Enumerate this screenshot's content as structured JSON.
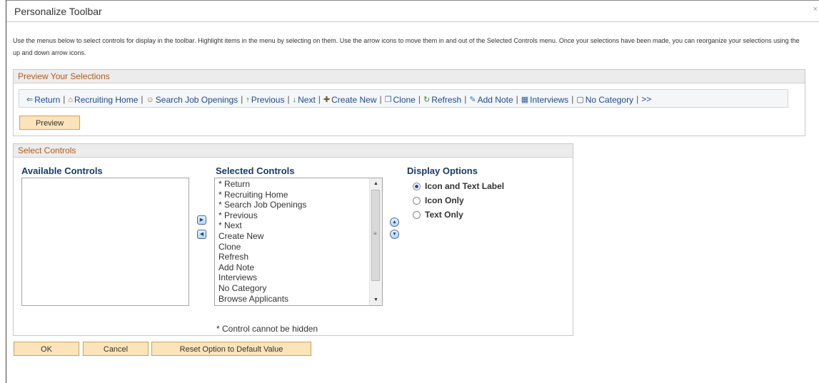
{
  "window": {
    "title": "Personalize Toolbar",
    "close_glyph": "×"
  },
  "intro": {
    "text": "Use the menus below to select controls for display in the toolbar. Highlight items in the menu by selecting on them. Use the arrow icons to move them in and out of the Selected Controls menu. Once your selections have been made, you can reorganize your selections using the up and down arrow icons."
  },
  "preview_section": {
    "title": "Preview Your Selections",
    "toolbar_items": [
      {
        "label": "Return",
        "icon": "return-arrow-icon"
      },
      {
        "label": "Recruiting Home",
        "icon": "home-icon"
      },
      {
        "label": "Search Job Openings",
        "icon": "search-people-icon"
      },
      {
        "label": "Previous",
        "icon": "previous-list-icon"
      },
      {
        "label": "Next",
        "icon": "next-list-icon"
      },
      {
        "label": "Create New",
        "icon": "create-new-icon"
      },
      {
        "label": "Clone",
        "icon": "clone-icon"
      },
      {
        "label": "Refresh",
        "icon": "refresh-icon"
      },
      {
        "label": "Add Note",
        "icon": "add-note-icon"
      },
      {
        "label": "Interviews",
        "icon": "calendar-icon"
      },
      {
        "label": "No Category",
        "icon": "dashed-box-icon"
      }
    ],
    "separator": "|",
    "more_label": ">>",
    "preview_button": "Preview"
  },
  "select_section": {
    "title": "Select Controls",
    "available_heading": "Available Controls",
    "selected_heading": "Selected Controls",
    "display_heading": "Display Options",
    "available_items": [],
    "selected_items": [
      "* Return",
      "* Recruiting Home",
      "* Search Job Openings",
      "* Previous",
      "* Next",
      "Create New",
      "Clone",
      "Refresh",
      "Add Note",
      "Interviews",
      "No Category",
      "Browse Applicants"
    ],
    "display_options": [
      {
        "label": "Icon and Text Label",
        "checked": true
      },
      {
        "label": "Icon Only",
        "checked": false
      },
      {
        "label": "Text Only",
        "checked": false
      }
    ],
    "footnote": "* Control cannot be hidden",
    "scroll_grip": "≡"
  },
  "footer": {
    "ok": "OK",
    "cancel": "Cancel",
    "reset": "Reset Option to Default Value"
  },
  "colors": {
    "link": "#1a4a9e",
    "section_title": "#b85a14",
    "heading": "#163c6a",
    "button_fill": "#fde3b9"
  }
}
